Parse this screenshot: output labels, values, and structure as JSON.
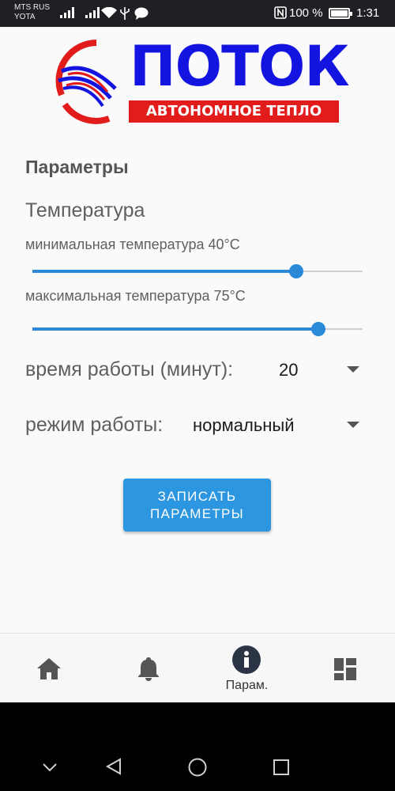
{
  "status_bar": {
    "carrier_line1": "MTS RUS",
    "carrier_line2": "YOTA",
    "battery_percent": "100 %",
    "time": "1:31",
    "icons": [
      "signal-icon",
      "signal-icon",
      "wifi-icon",
      "usb-icon",
      "chat-icon",
      "nfc-icon",
      "battery-icon"
    ]
  },
  "logo": {
    "title": "ПОТОК",
    "subtitle": "АВТОНОМНОЕ ТЕПЛО",
    "title_color": "#1414e0",
    "accent_color": "#e21b1b"
  },
  "params": {
    "section_title": "Параметры",
    "temperature_title": "Температура",
    "min_temp": {
      "label": "минимальная температура 40°C",
      "slider_fraction": 0.8
    },
    "max_temp": {
      "label": "максимальная температура 75°C",
      "slider_fraction": 0.867
    },
    "work_time": {
      "label": "время работы (минут):",
      "value": "20"
    },
    "mode": {
      "label": "режим работы:",
      "value": "нормальный"
    },
    "submit_line1": "ЗАПИСАТЬ",
    "submit_line2": "ПАРАМЕТРЫ",
    "accent_color": "#2d96e0"
  },
  "tabs": [
    {
      "icon": "home-icon",
      "label": ""
    },
    {
      "icon": "bell-icon",
      "label": ""
    },
    {
      "icon": "info-icon",
      "label": "Парам.",
      "active": true
    },
    {
      "icon": "dashboard-icon",
      "label": ""
    }
  ],
  "nav_bar": {
    "buttons": [
      "chevron-down-icon",
      "back-icon",
      "home-circle-icon",
      "recents-icon"
    ]
  }
}
